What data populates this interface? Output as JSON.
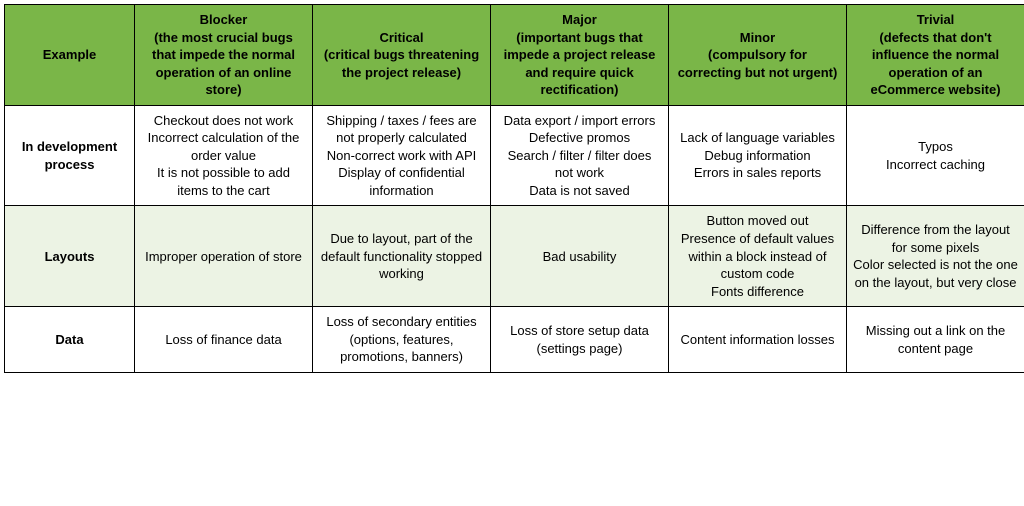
{
  "headers": {
    "example": {
      "title": "Example",
      "sub": ""
    },
    "blocker": {
      "title": "Blocker",
      "sub": "(the most crucial bugs that impede the normal operation of an online store)"
    },
    "critical": {
      "title": "Critical",
      "sub": "(critical bugs threatening the project release)"
    },
    "major": {
      "title": "Major",
      "sub": "(important bugs that impede a project release and require quick rectification)"
    },
    "minor": {
      "title": "Minor",
      "sub": "(compulsory for correcting but not urgent)"
    },
    "trivial": {
      "title": "Trivial",
      "sub": "(defects that don't influence the normal operation of an eCommerce website)"
    }
  },
  "rows": [
    {
      "label": "In development process",
      "cells": {
        "blocker": [
          "Checkout does not work",
          "Incorrect calculation of the order value",
          "It is not possible to add items to the cart"
        ],
        "critical": [
          "Shipping / taxes / fees are not properly calculated",
          "Non-correct work with API",
          "Display of confidential information"
        ],
        "major": [
          "Data export / import errors",
          "Defective promos",
          "Search / filter / filter does not work",
          "Data is not saved"
        ],
        "minor": [
          "Lack of language variables",
          "Debug information",
          "Errors in sales reports"
        ],
        "trivial": [
          "Typos",
          "Incorrect caching"
        ]
      }
    },
    {
      "label": "Layouts",
      "cells": {
        "blocker": [
          "Improper operation of store"
        ],
        "critical": [
          "Due to layout, part of the default functionality stopped working"
        ],
        "major": [
          "Bad usability"
        ],
        "minor": [
          "Button moved out",
          "Presence of default values within a block instead of custom code",
          "Fonts difference"
        ],
        "trivial": [
          "Difference from the layout for some pixels",
          "Color selected is not the one on the layout, but very close"
        ]
      }
    },
    {
      "label": "Data",
      "cells": {
        "blocker": [
          "Loss of finance data"
        ],
        "critical": [
          "Loss of secondary entities (options, features, promotions, banners)"
        ],
        "major": [
          "Loss of store setup data (settings page)"
        ],
        "minor": [
          "Content information losses"
        ],
        "trivial": [
          "Missing out a link on the content page"
        ]
      }
    }
  ]
}
